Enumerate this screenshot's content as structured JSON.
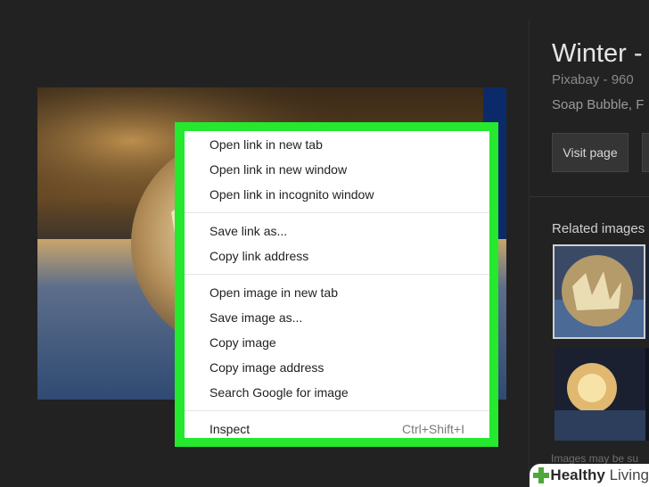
{
  "image_panel": {
    "title": "Winter - ",
    "source": "Pixabay - 960",
    "tags": "Soap Bubble, F",
    "visit_button": "Visit page",
    "related_label": "Related images",
    "disclaimer": "Images may be su"
  },
  "context_menu": {
    "groups": [
      [
        "Open link in new tab",
        "Open link in new window",
        "Open link in incognito window"
      ],
      [
        "Save link as...",
        "Copy link address"
      ],
      [
        "Open image in new tab",
        "Save image as...",
        "Copy image",
        "Copy image address",
        "Search Google for image"
      ]
    ],
    "inspect": {
      "label": "Inspect",
      "shortcut": "Ctrl+Shift+I"
    },
    "highlight_color": "#25e82f"
  },
  "watermark": {
    "brand": "Healthy",
    "suffix": "Living"
  }
}
